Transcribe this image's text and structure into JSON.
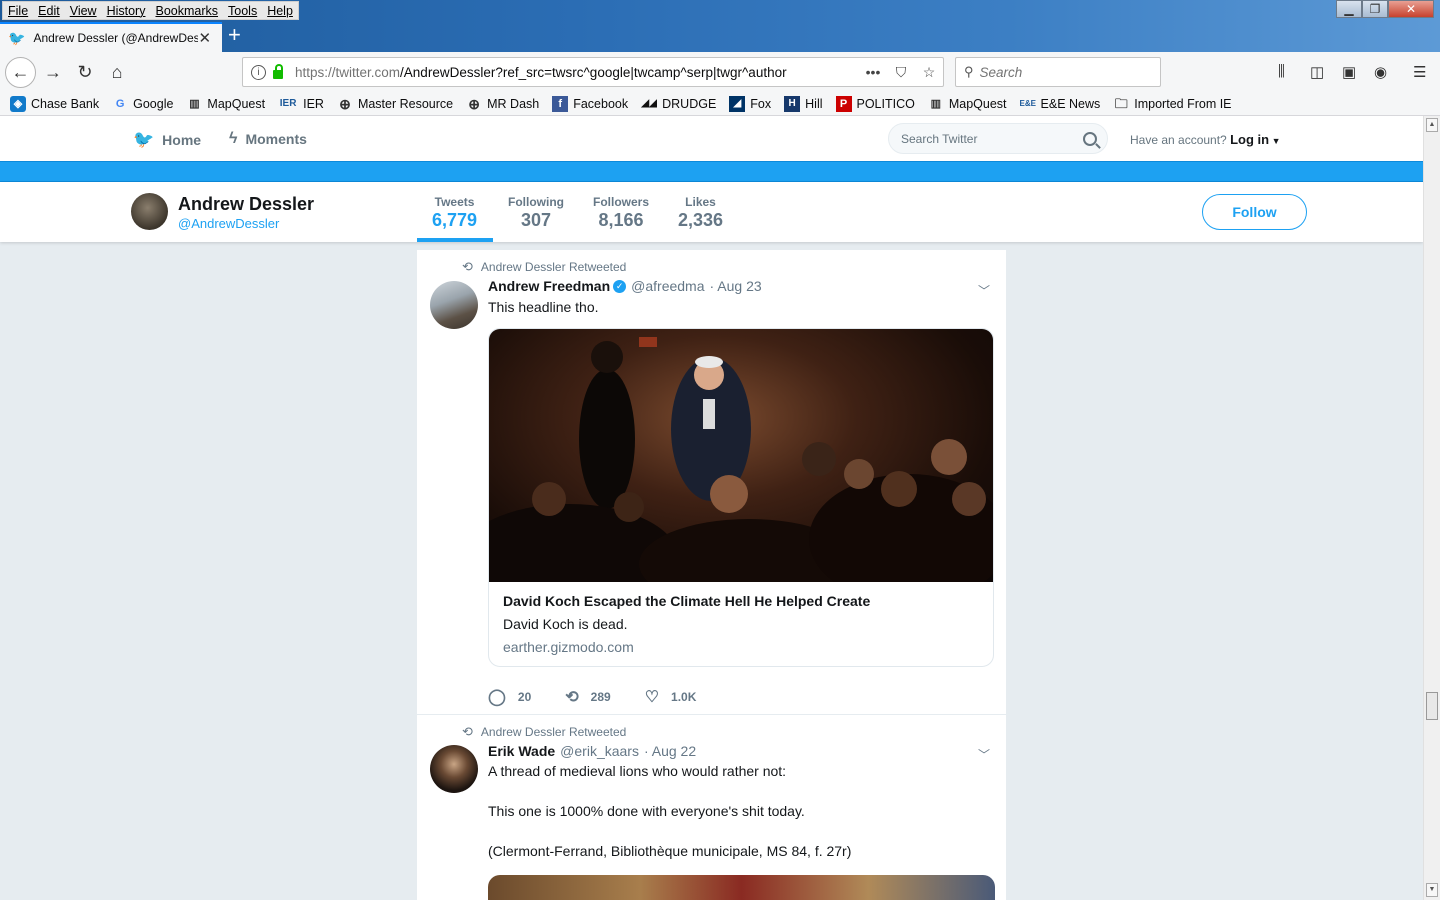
{
  "browser": {
    "menu": [
      "File",
      "Edit",
      "View",
      "History",
      "Bookmarks",
      "Tools",
      "Help"
    ],
    "tab_title": "Andrew Dessler (@AndrewDess",
    "url_host": "https://twitter.com",
    "url_path": "/AndrewDessler?ref_src=twsrc^google|twcamp^serp|twgr^author",
    "search_placeholder": "Search",
    "bookmarks": [
      {
        "label": "Chase Bank",
        "icon": "chase-icon"
      },
      {
        "label": "Google",
        "icon": "google-icon"
      },
      {
        "label": "MapQuest",
        "icon": "mapquest-icon"
      },
      {
        "label": "IER",
        "icon": "ier-icon",
        "icon_text": "IER"
      },
      {
        "label": "Master Resource",
        "icon": "globe-icon"
      },
      {
        "label": "MR Dash",
        "icon": "globe-icon"
      },
      {
        "label": "Facebook",
        "icon": "facebook-icon"
      },
      {
        "label": "DRUDGE",
        "icon": "drudge-icon"
      },
      {
        "label": "Fox",
        "icon": "fox-icon"
      },
      {
        "label": "Hill",
        "icon": "hill-icon"
      },
      {
        "label": "POLITICO",
        "icon": "politico-icon"
      },
      {
        "label": "MapQuest",
        "icon": "mapquest-icon"
      },
      {
        "label": "E&E News",
        "icon": "ee-icon"
      },
      {
        "label": "Imported From IE",
        "icon": "folder-icon"
      }
    ]
  },
  "twitter": {
    "nav": {
      "home": "Home",
      "moments": "Moments"
    },
    "search_placeholder": "Search Twitter",
    "account_prompt": "Have an account?",
    "login": "Log in",
    "profile": {
      "name": "Andrew Dessler",
      "handle": "@AndrewDessler",
      "follow": "Follow",
      "stats": [
        {
          "label": "Tweets",
          "value": "6,779"
        },
        {
          "label": "Following",
          "value": "307"
        },
        {
          "label": "Followers",
          "value": "8,166"
        },
        {
          "label": "Likes",
          "value": "2,336"
        }
      ]
    },
    "tweets": [
      {
        "retweet_note": "Andrew Dessler Retweeted",
        "name": "Andrew Freedman",
        "handle": "@afreedma",
        "date": "· Aug 23",
        "text": "This headline tho.",
        "card": {
          "title": "David Koch Escaped the Climate Hell He Helped Create",
          "desc": "David Koch is dead.",
          "domain": "earther.gizmodo.com"
        },
        "replies": "20",
        "retweets": "289",
        "likes": "1.0K"
      },
      {
        "retweet_note": "Andrew Dessler Retweeted",
        "name": "Erik Wade",
        "handle": "@erik_kaars",
        "date": "· Aug 22",
        "line1": "A thread of medieval lions who would rather not:",
        "line2": "This one is 1000% done with everyone's shit today.",
        "line3": "(Clermont-Ferrand, Bibliothèque municipale, MS 84, f. 27r)"
      }
    ]
  },
  "colors": {
    "twitter_blue": "#1da1f2",
    "timeline_bg": "#e6ecf0"
  }
}
